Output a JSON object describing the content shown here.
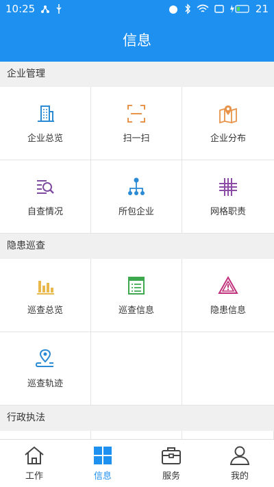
{
  "status": {
    "time": "10:25",
    "battery": "21"
  },
  "title": "信息",
  "sections": [
    {
      "header": "企业管理",
      "items": [
        {
          "label": "企业总览",
          "icon": "building-icon"
        },
        {
          "label": "扫一扫",
          "icon": "scan-icon"
        },
        {
          "label": "企业分布",
          "icon": "map-pin-icon"
        },
        {
          "label": "自查情况",
          "icon": "search-list-icon"
        },
        {
          "label": "所包企业",
          "icon": "org-tree-icon"
        },
        {
          "label": "网格职责",
          "icon": "grid-icon"
        }
      ]
    },
    {
      "header": "隐患巡查",
      "items": [
        {
          "label": "巡查总览",
          "icon": "bar-chart-icon"
        },
        {
          "label": "巡查信息",
          "icon": "list-icon"
        },
        {
          "label": "隐患信息",
          "icon": "warning-icon"
        },
        {
          "label": "巡查轨迹",
          "icon": "track-icon"
        }
      ]
    },
    {
      "header": "行政执法",
      "items": []
    }
  ],
  "tabs": [
    {
      "label": "工作",
      "icon": "home-icon"
    },
    {
      "label": "信息",
      "icon": "tiles-icon"
    },
    {
      "label": "服务",
      "icon": "toolbox-icon"
    },
    {
      "label": "我的",
      "icon": "person-icon"
    }
  ],
  "colors": {
    "accent": "#1e90f0",
    "building": "#2a8ad4",
    "scan": "#e8934a",
    "map": "#e8934a",
    "search": "#7e4aa0",
    "tree": "#2a8ad4",
    "grid": "#8a4aa6",
    "chart": "#e8b84a",
    "list": "#3ea84e",
    "warning": "#c0307a",
    "track": "#2a8ad4"
  }
}
